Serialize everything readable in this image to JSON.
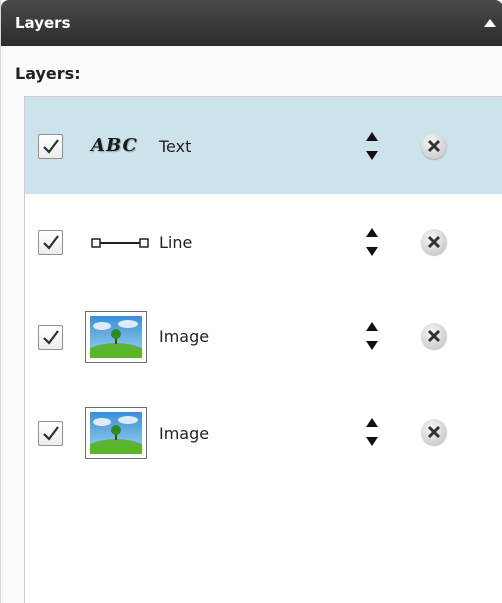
{
  "panel": {
    "title": "Layers",
    "section_label": "Layers:"
  },
  "layers": [
    {
      "label": "Text",
      "type": "text",
      "icon_text": "ABC",
      "checked": true,
      "selected": true
    },
    {
      "label": "Line",
      "type": "line",
      "checked": true,
      "selected": false
    },
    {
      "label": "Image",
      "type": "image",
      "checked": true,
      "selected": false
    },
    {
      "label": "Image",
      "type": "image",
      "checked": true,
      "selected": false
    }
  ],
  "colors": {
    "header_bg": "#2c2c2c",
    "selected_row_bg": "#cde3ec"
  }
}
